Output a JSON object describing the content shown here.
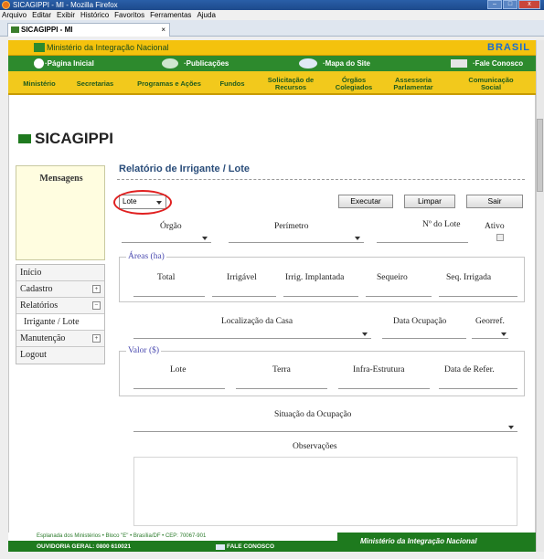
{
  "browser": {
    "window_title": "SICAGIPPI - MI - Mozilla Firefox",
    "menu": [
      "Arquivo",
      "Editar",
      "Exibir",
      "Histórico",
      "Favoritos",
      "Ferramentas",
      "Ajuda"
    ],
    "tab_title": "SICAGIPPI - MI",
    "tab_close": "×",
    "win_buttons": [
      "–",
      "□",
      "x"
    ]
  },
  "header": {
    "ministry": "Ministério da Integração Nacional",
    "brand": "BRASIL",
    "top_links": [
      "·Página Inicial",
      "·Publicações",
      "·Mapa do Site",
      "·Fale Conosco"
    ],
    "nav": [
      "Ministério",
      "Secretarias",
      "Programas e Ações",
      "Fundos",
      "Solicitação de Recursos",
      "Órgãos Colegiados",
      "Assessoria Parlamentar",
      "Comunicação Social"
    ]
  },
  "app": {
    "title": "SICAGIPPI"
  },
  "sidebar": {
    "messages_title": "Mensagens",
    "items": [
      {
        "label": "Início",
        "pm": ""
      },
      {
        "label": "Cadastro",
        "pm": "+"
      },
      {
        "label": "Relatórios",
        "pm": "−"
      },
      {
        "label": "Irrigante / Lote",
        "pm": ""
      },
      {
        "label": "Manutenção",
        "pm": "+"
      },
      {
        "label": "Logout",
        "pm": ""
      }
    ]
  },
  "form": {
    "title": "Relatório de Irrigante / Lote",
    "select_value": "Lote",
    "buttons": {
      "execute": "Executar",
      "clear": "Limpar",
      "exit": "Sair"
    },
    "row1": {
      "orgao": "Órgão",
      "perimetro": "Perímetro",
      "num_lote": "Nº do Lote",
      "ativo": "Ativo"
    },
    "areas": {
      "legend": "Áreas (ha)",
      "cols": [
        "Total",
        "Irrigável",
        "Irrig. Implantada",
        "Sequeiro",
        "Seq. Irrigada"
      ]
    },
    "row3": {
      "localizacao": "Localização da Casa",
      "data_ocupacao": "Data Ocupação",
      "georef": "Georref."
    },
    "valor": {
      "legend": "Valor ($)",
      "cols": [
        "Lote",
        "Terra",
        "Infra-Estrutura",
        "Data de Refer."
      ]
    },
    "situacao": "Situação da Ocupação",
    "observacoes": "Observações"
  },
  "footer": {
    "address": "Esplanada dos Ministérios • Bloco \"E\" • Brasília/DF • CEP: 70067-901",
    "ouvidoria": "OUVIDORIA GERAL: 0800 610021",
    "fale": "FALE CONOSCO",
    "ministry": "Ministério da Integração Nacional"
  }
}
